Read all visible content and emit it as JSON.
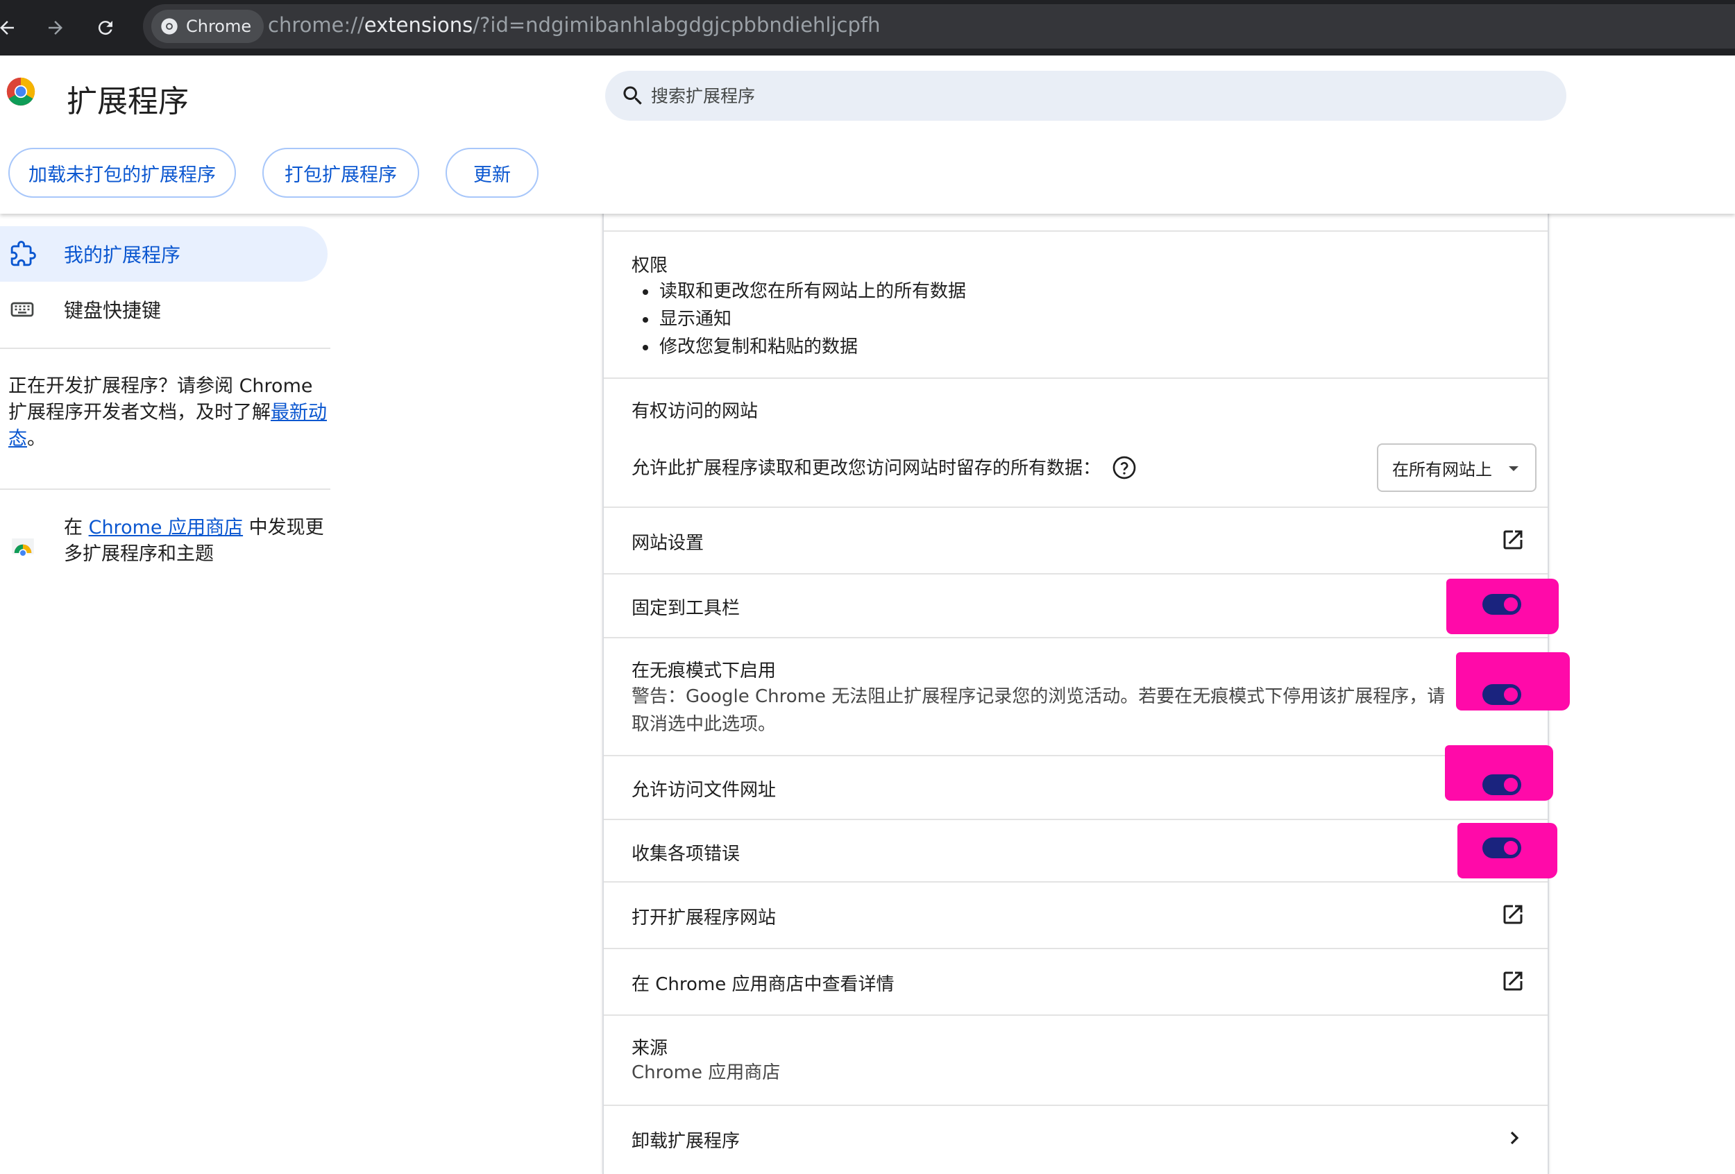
{
  "browser": {
    "chip_label": "Chrome",
    "url_prefix": "chrome://",
    "url_host": "extensions",
    "url_rest": "/?id=ndgimibanhlabgdgjcpbbndiehljcpfh"
  },
  "header": {
    "title": "扩展程序",
    "search_placeholder": "搜索扩展程序",
    "buttons": {
      "load_unpacked": "加载未打包的扩展程序",
      "pack": "打包扩展程序",
      "update": "更新"
    }
  },
  "sidebar": {
    "items": [
      {
        "label": "我的扩展程序",
        "icon": "puzzle-icon",
        "active": true
      },
      {
        "label": "键盘快捷键",
        "icon": "keyboard-icon",
        "active": false
      }
    ],
    "dev_text_1": "正在开发扩展程序？请参阅 Chrome 扩展程序开发者文档，及时了解",
    "dev_link": "最新动态",
    "dev_text_end": "。",
    "store_prefix": "在 ",
    "store_link": "Chrome 应用商店",
    "store_suffix": " 中发现更多扩展程序和主题"
  },
  "details": {
    "permissions": {
      "label": "权限",
      "items": [
        "读取和更改您在所有网站上的所有数据",
        "显示通知",
        "修改您复制和粘贴的数据"
      ]
    },
    "site_access": {
      "label": "有权访问的网站",
      "desc": "允许此扩展程序读取和更改您访问网站时留存的所有数据：",
      "selected": "在所有网站上"
    },
    "site_settings": "网站设置",
    "pin_toolbar": "固定到工具栏",
    "incognito": {
      "label": "在无痕模式下启用",
      "warning": "警告：Google Chrome 无法阻止扩展程序记录您的浏览活动。若要在无痕模式下停用该扩展程序，请取消选中此选项。"
    },
    "file_urls": "允许访问文件网址",
    "collect_errors": "收集各项错误",
    "open_site": "打开扩展程序网站",
    "view_store": "在 Chrome 应用商店中查看详情",
    "source": {
      "label": "来源",
      "value": "Chrome 应用商店"
    },
    "remove": "卸载扩展程序",
    "toggles": {
      "pin_toolbar": true,
      "incognito": true,
      "file_urls": true,
      "collect_errors": true
    }
  },
  "colors": {
    "accent": "#0b57d0",
    "highlight": "#ff0aa9",
    "toggle_track": "#1a237e"
  }
}
